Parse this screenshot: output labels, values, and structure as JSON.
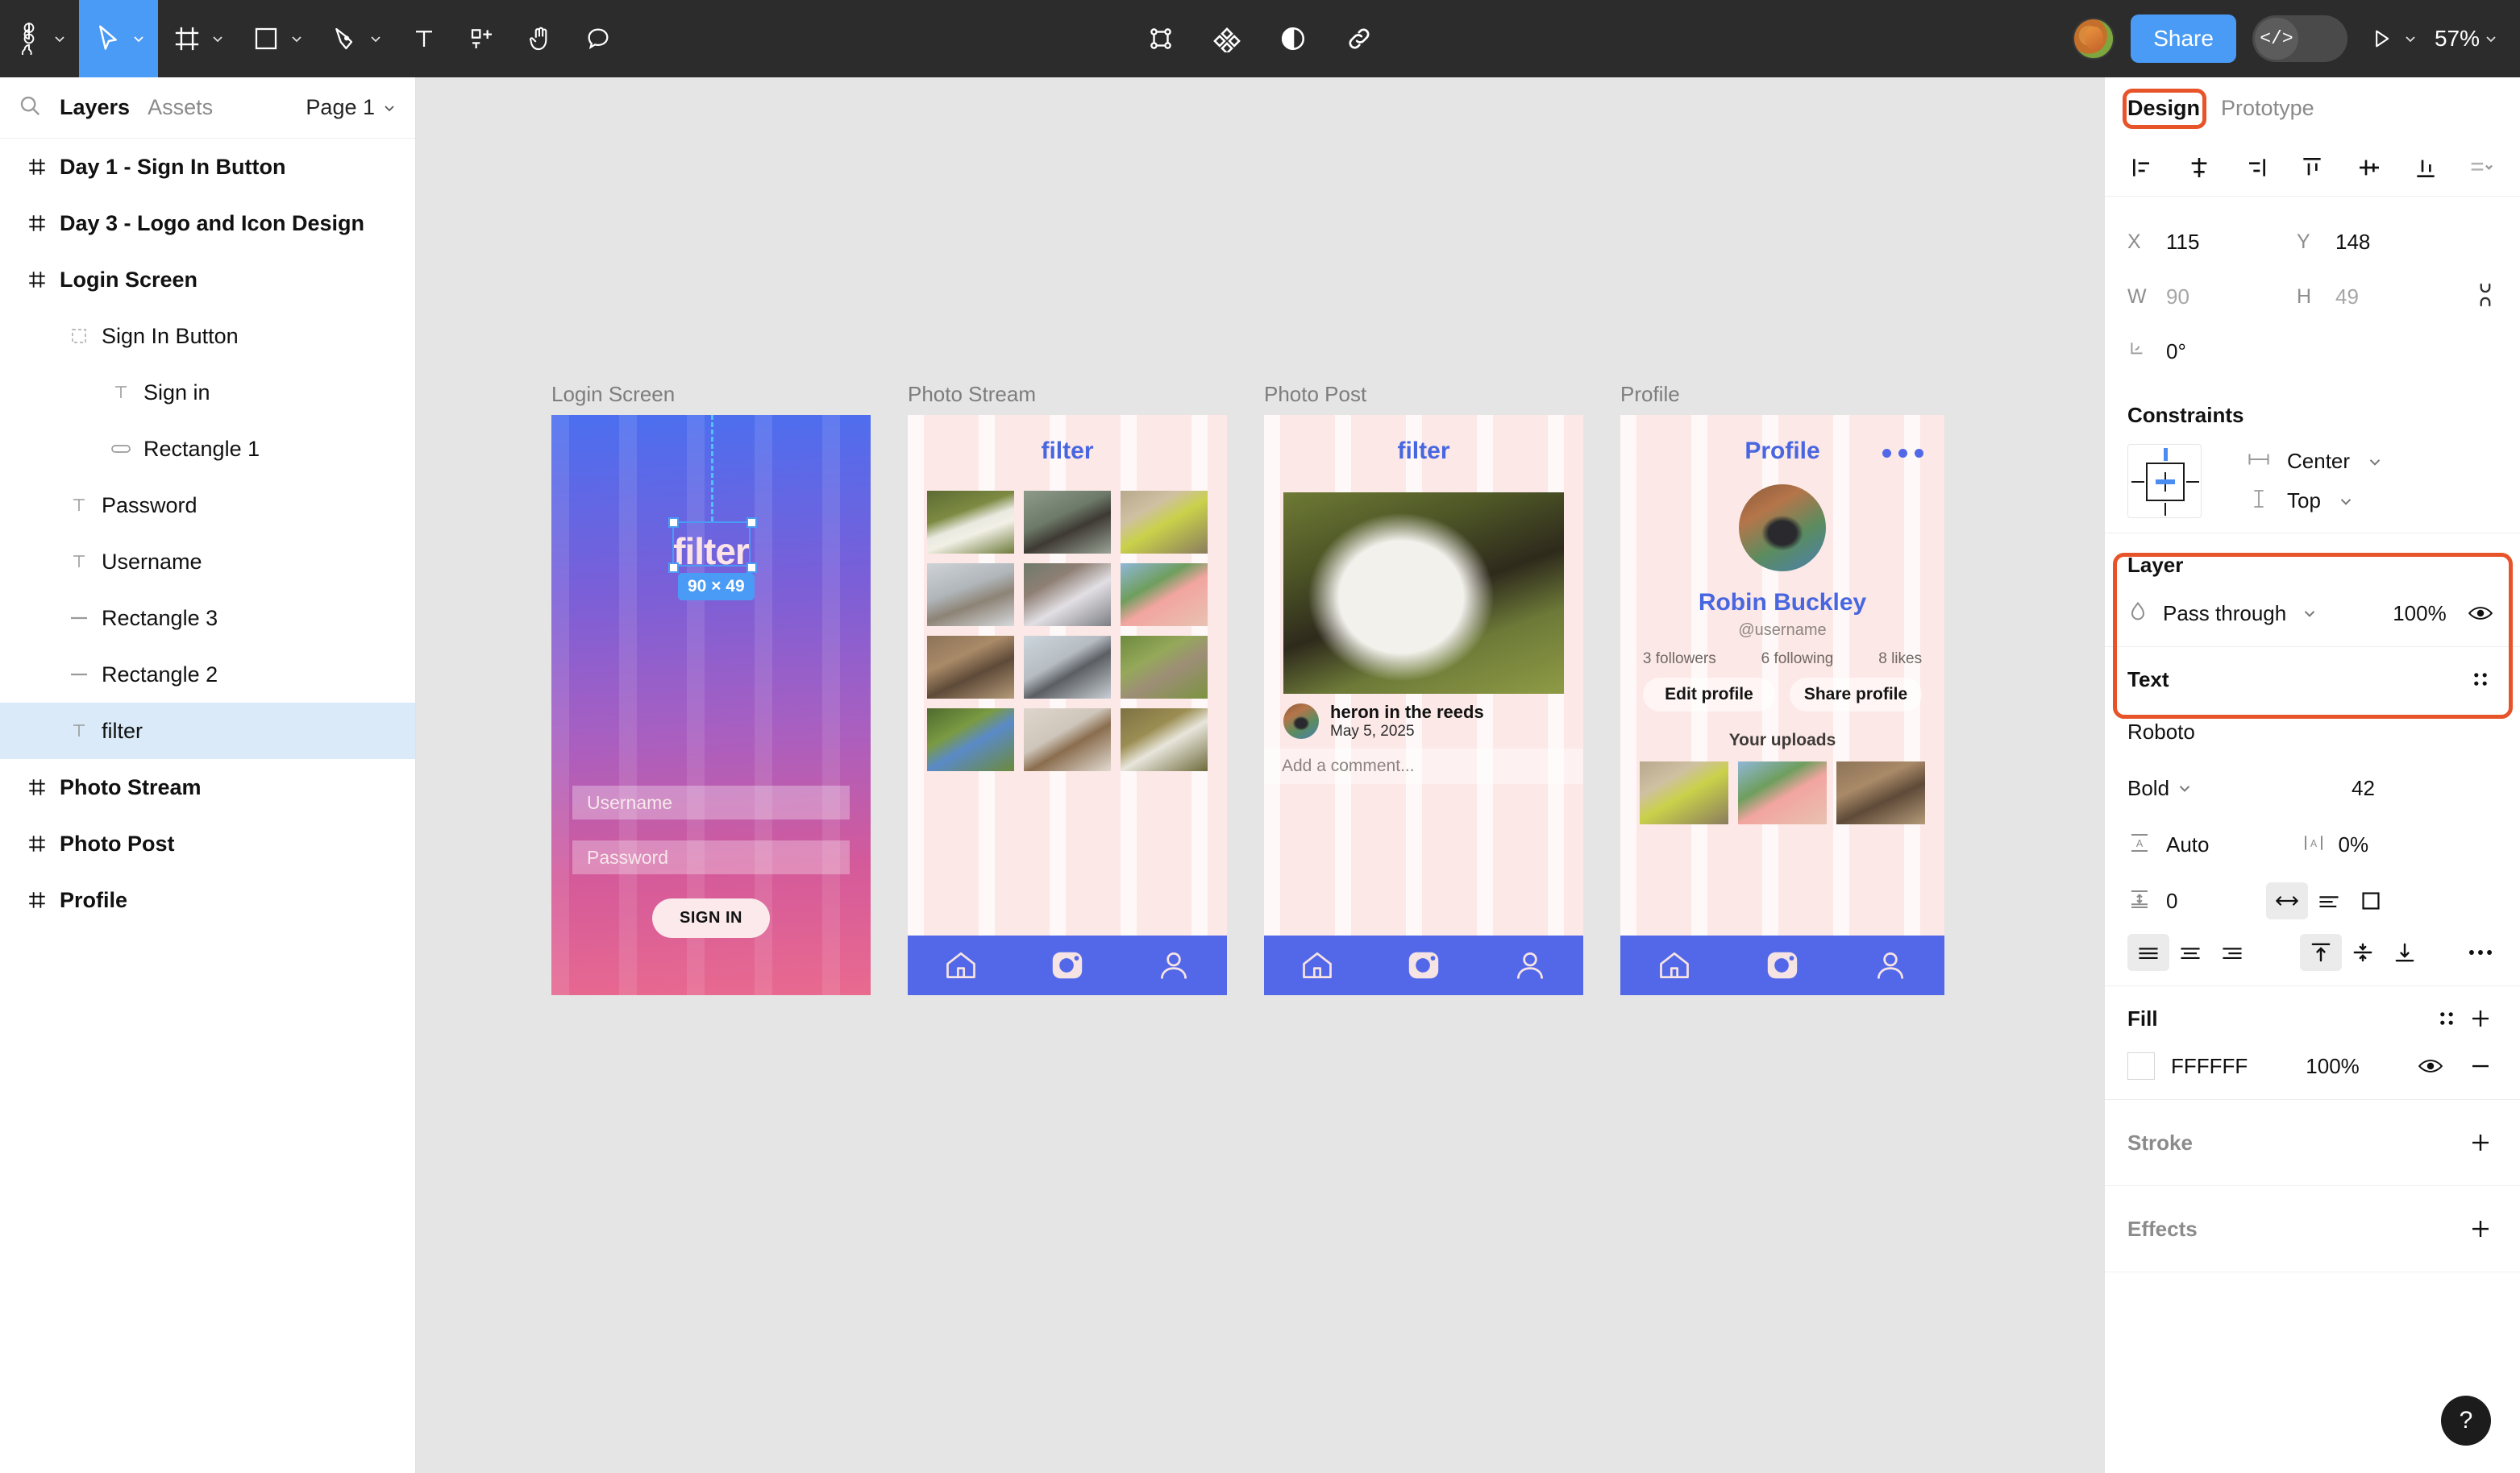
{
  "toolbar": {
    "menu_icon": "figma-logo-icon",
    "tools": [
      {
        "name": "main-menu",
        "icon": "figma-logo-icon",
        "caret": true,
        "active": false
      },
      {
        "name": "move-tool",
        "icon": "cursor-arrow-icon",
        "caret": true,
        "active": true
      },
      {
        "name": "frame-tool",
        "icon": "frame-icon",
        "caret": true,
        "active": false
      },
      {
        "name": "shape-tool",
        "icon": "rectangle-icon",
        "caret": true,
        "active": false
      },
      {
        "name": "pen-tool",
        "icon": "pen-icon",
        "caret": true,
        "active": false
      },
      {
        "name": "text-tool",
        "icon": "text-t-icon",
        "caret": false,
        "active": false
      },
      {
        "name": "resources-tool",
        "icon": "add-component-icon",
        "caret": false,
        "active": false
      },
      {
        "name": "hand-tool",
        "icon": "hand-icon",
        "caret": false,
        "active": false
      },
      {
        "name": "comment-tool",
        "icon": "comment-bubble-icon",
        "caret": false,
        "active": false
      }
    ],
    "center_tools": [
      {
        "name": "selection-frame",
        "icon": "selection-bounds-icon"
      },
      {
        "name": "components",
        "icon": "component-diamond-icon"
      },
      {
        "name": "contrast",
        "icon": "half-circle-contrast-icon"
      },
      {
        "name": "link",
        "icon": "chain-link-icon"
      }
    ],
    "avatar": "user-avatar-squirrel",
    "share_label": "Share",
    "dev_mode_icon": "code-brackets-icon",
    "present_icon": "play-triangle-icon",
    "zoom_level": "57%"
  },
  "left_panel": {
    "search_icon": "search-icon",
    "tabs": [
      {
        "label": "Layers",
        "selected": true
      },
      {
        "label": "Assets",
        "selected": false
      }
    ],
    "page_label": "Page 1",
    "layers": [
      {
        "label": "Day 1 - Sign In Button",
        "icon": "frame-hash-icon",
        "depth": 1,
        "bold": true,
        "selected": false
      },
      {
        "label": "Day 3 - Logo and Icon Design",
        "icon": "frame-hash-icon",
        "depth": 1,
        "bold": true,
        "selected": false
      },
      {
        "label": "Login Screen",
        "icon": "frame-hash-icon",
        "depth": 1,
        "bold": true,
        "selected": false
      },
      {
        "label": "Sign In Button",
        "icon": "group-dashed-icon",
        "depth": 2,
        "bold": false,
        "selected": false
      },
      {
        "label": "Sign in",
        "icon": "text-t-icon",
        "depth": 3,
        "bold": false,
        "selected": false
      },
      {
        "label": "Rectangle 1",
        "icon": "rounded-rect-icon",
        "depth": 3,
        "bold": false,
        "selected": false
      },
      {
        "label": "Password",
        "icon": "text-t-icon",
        "depth": 2,
        "bold": false,
        "selected": false
      },
      {
        "label": "Username",
        "icon": "text-t-icon",
        "depth": 2,
        "bold": false,
        "selected": false
      },
      {
        "label": "Rectangle 3",
        "icon": "line-dash-icon",
        "depth": 2,
        "bold": false,
        "selected": false
      },
      {
        "label": "Rectangle 2",
        "icon": "line-dash-icon",
        "depth": 2,
        "bold": false,
        "selected": false
      },
      {
        "label": "filter",
        "icon": "text-t-icon",
        "depth": 2,
        "bold": false,
        "selected": true
      },
      {
        "label": "Photo Stream",
        "icon": "frame-hash-icon",
        "depth": 1,
        "bold": true,
        "selected": false
      },
      {
        "label": "Photo Post",
        "icon": "frame-hash-icon",
        "depth": 1,
        "bold": true,
        "selected": false
      },
      {
        "label": "Profile",
        "icon": "frame-hash-icon",
        "depth": 1,
        "bold": true,
        "selected": false
      }
    ]
  },
  "canvas": {
    "background_color": "#e5e5e5",
    "frames": [
      {
        "title": "Login Screen"
      },
      {
        "title": "Photo Stream"
      },
      {
        "title": "Photo Post"
      },
      {
        "title": "Profile"
      }
    ],
    "login_screen": {
      "title": "Login Screen",
      "logo_text": "filter",
      "selection_badge": "90 × 49",
      "username_placeholder": "Username",
      "password_placeholder": "Password",
      "signin_label": "SIGN IN",
      "gradient_from": "#4a6ff0",
      "gradient_to": "#e96a8f"
    },
    "photo_stream": {
      "title": "Photo Stream",
      "app_header": "filter",
      "nav": [
        "home-icon",
        "camera-icon",
        "person-icon"
      ],
      "thumbnails": [
        "great-egret-in-grass",
        "crested-kingfisher",
        "yellow-pine-warbler",
        "hawk-in-flight",
        "snowy-owl",
        "flamingo-head",
        "coconut-birdhouse",
        "white-wagtail-on-rocks",
        "sparrow-on-moss",
        "kingfisher-flying",
        "waxwing-on-wire",
        "egret-wading"
      ]
    },
    "photo_post": {
      "title": "Photo Post",
      "app_header": "filter",
      "photo": "snowy-egret-in-reeds",
      "post_title": "heron in the reeds",
      "post_date": "May 5, 2025",
      "comment_placeholder": "Add a comment...",
      "nav": [
        "home-icon",
        "camera-icon",
        "person-icon"
      ]
    },
    "profile": {
      "title": "Profile",
      "app_header": "Profile",
      "more_icon": "more-dots-icon",
      "avatar": "person-with-binoculars",
      "name": "Robin Buckley",
      "handle": "@username",
      "stats": [
        "3 followers",
        "6 following",
        "8 likes"
      ],
      "edit_label": "Edit profile",
      "share_label": "Share profile",
      "uploads_label": "Your uploads",
      "uploads": [
        "yellow-pine-warbler",
        "flamingo-head",
        "coconut-birdhouse"
      ],
      "nav": [
        "home-icon",
        "camera-icon",
        "person-icon"
      ]
    }
  },
  "right_panel": {
    "tabs": [
      {
        "label": "Design",
        "selected": true,
        "highlighted": true
      },
      {
        "label": "Prototype",
        "selected": false,
        "highlighted": false
      }
    ],
    "highlight_color": "#e8542a",
    "align_buttons": [
      "align-left-icon",
      "align-horizontal-center-icon",
      "align-right-icon",
      "align-top-icon",
      "align-vertical-center-icon",
      "align-bottom-icon",
      "distribute-menu-icon"
    ],
    "position": {
      "x_label": "X",
      "x_value": "115",
      "y_label": "Y",
      "y_value": "148",
      "w_label": "W",
      "w_value": "90",
      "h_label": "H",
      "h_value": "49",
      "rotation_value": "0°",
      "constrain_icon": "link-proportions-icon"
    },
    "constraints": {
      "title": "Constraints",
      "widget_icon": "constraints-widget-icon",
      "horizontal_icon": "horizontal-resize-icon",
      "horizontal_value": "Center",
      "vertical_icon": "vertical-resize-icon",
      "vertical_value": "Top"
    },
    "layer": {
      "title": "Layer",
      "blend_icon": "blend-drop-icon",
      "blend_mode": "Pass through",
      "opacity": "100%",
      "visibility_icon": "eye-icon"
    },
    "text": {
      "title": "Text",
      "settings_icon": "type-settings-icon",
      "font_family": "Roboto",
      "font_weight": "Bold",
      "font_size": "42",
      "line_height_icon": "line-height-icon",
      "line_height": "Auto",
      "letter_spacing_icon": "letter-spacing-icon",
      "letter_spacing": "0%",
      "paragraph_spacing_icon": "paragraph-spacing-icon",
      "paragraph_spacing": "0",
      "resize_modes": [
        "auto-width-icon",
        "auto-height-icon",
        "fixed-size-icon"
      ],
      "align_h": [
        "align-text-left-icon",
        "align-text-center-icon",
        "align-text-right-icon"
      ],
      "align_v": [
        "align-text-top-icon",
        "align-text-middle-icon",
        "align-text-bottom-icon"
      ],
      "more_icon": "more-options-icon"
    },
    "fill": {
      "title": "Fill",
      "settings_icon": "style-settings-icon",
      "add_icon": "plus-icon",
      "color_hex": "FFFFFF",
      "opacity": "100%",
      "visibility_icon": "eye-icon",
      "remove_icon": "minus-icon"
    },
    "stroke": {
      "title": "Stroke",
      "add_icon": "plus-icon"
    },
    "effects": {
      "title": "Effects",
      "add_icon": "plus-icon"
    },
    "help_label": "?"
  }
}
